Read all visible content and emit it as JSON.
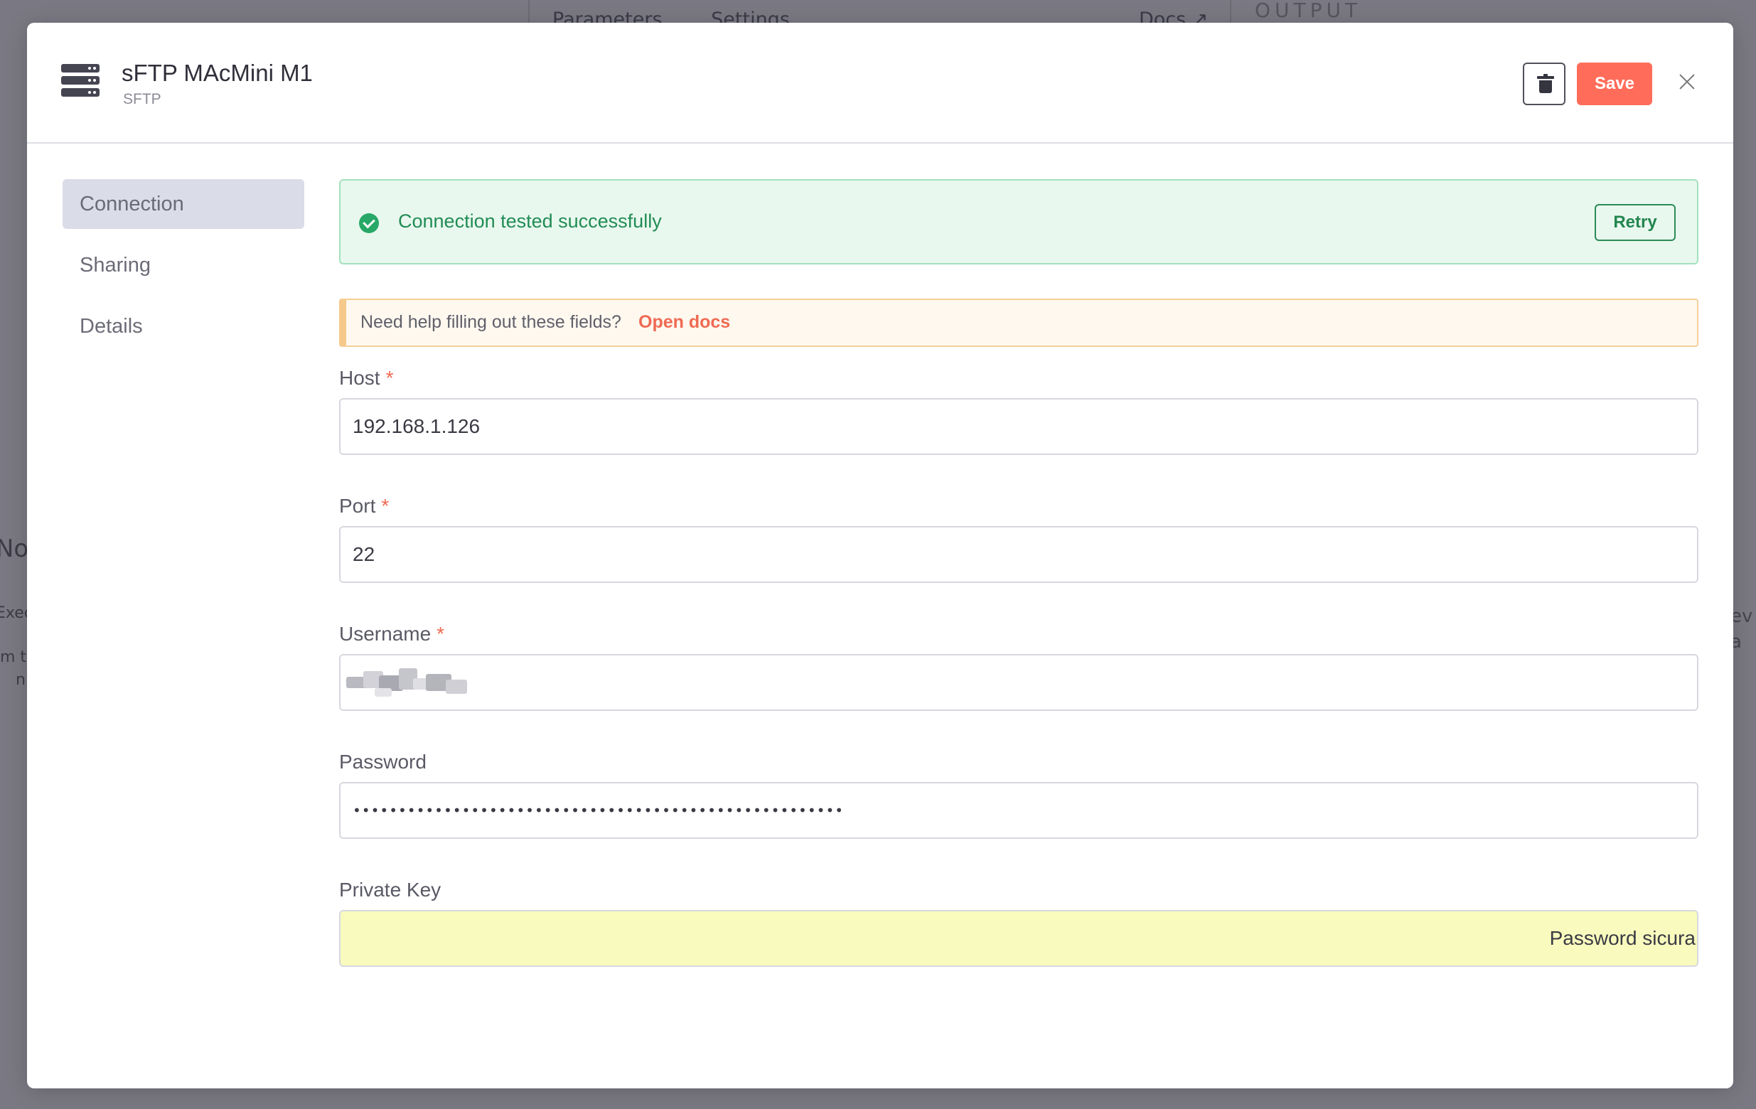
{
  "background": {
    "tabs": [
      "Parameters",
      "Settings"
    ],
    "docs": "Docs ↗",
    "output": "OUTPUT",
    "left_fragments": [
      "No",
      "Exec",
      "m th",
      "n"
    ],
    "right_fragments": [
      "ev",
      "a"
    ]
  },
  "header": {
    "icon": "server-icon",
    "title": "sFTP MAcMini M1",
    "subtitle": "SFTP",
    "save_label": "Save"
  },
  "sidebar": {
    "items": [
      {
        "label": "Connection",
        "active": true
      },
      {
        "label": "Sharing",
        "active": false
      },
      {
        "label": "Details",
        "active": false
      }
    ]
  },
  "status": {
    "message": "Connection tested successfully",
    "retry_label": "Retry"
  },
  "help": {
    "text": "Need help filling out these fields?",
    "link": "Open docs"
  },
  "fields": {
    "host": {
      "label": "Host",
      "required": "*",
      "value": "192.168.1.126"
    },
    "port": {
      "label": "Port",
      "required": "*",
      "value": "22"
    },
    "username": {
      "label": "Username",
      "required": "*",
      "value": ""
    },
    "password": {
      "label": "Password",
      "value": "••••••••••••••••••••••••••••••••••••••••••••••••••••••"
    },
    "private_key": {
      "label": "Private Key",
      "value": "Password sicura"
    }
  },
  "colors": {
    "accent": "#ff6d5a",
    "success": "#27a866",
    "warning_border": "#f5c98a",
    "key_fill": "#f8fbbd"
  }
}
